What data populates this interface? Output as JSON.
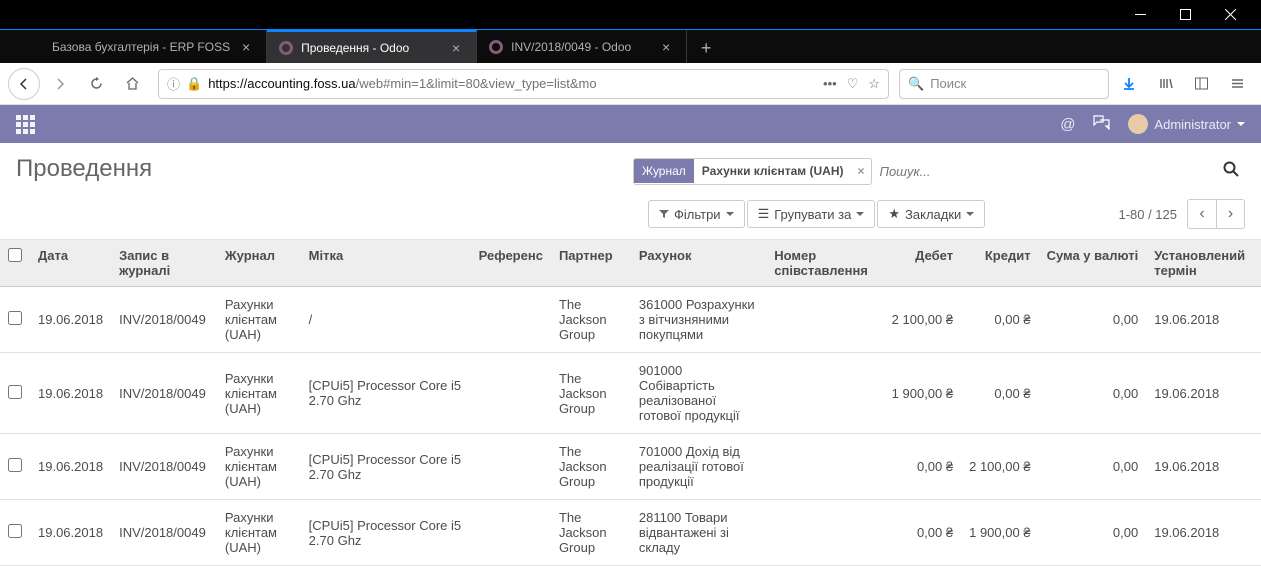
{
  "browser": {
    "tabs": [
      {
        "title": "Базова бухгалтерія - ERP FOSS",
        "icon": "generic"
      },
      {
        "title": "Проведення - Odoo",
        "icon": "odoo"
      },
      {
        "title": "INV/2018/0049 - Odoo",
        "icon": "odoo"
      }
    ],
    "url": {
      "host": "https://accounting.foss.ua",
      "path": "/web#min=1&limit=80&view_type=list&mo"
    },
    "search_placeholder": "Поиск"
  },
  "header": {
    "user": "Administrator"
  },
  "breadcrumb": "Проведення",
  "search": {
    "facet_label": "Журнал",
    "facet_value": "Рахунки клієнтам (UAH)",
    "placeholder": "Пошук..."
  },
  "toolbar": {
    "filters": "Фільтри",
    "groupby": "Групувати за",
    "favorites": "Закладки",
    "pager": "1-80 / 125"
  },
  "columns": {
    "date": "Дата",
    "journal_entry": "Запис в журналі",
    "journal": "Журнал",
    "label": "Мітка",
    "reference": "Референс",
    "partner": "Партнер",
    "account": "Рахунок",
    "matching": "Номер співставлення",
    "debit": "Дебет",
    "credit": "Кредит",
    "amount_currency": "Сума у валюті",
    "due_date": "Установлений термін"
  },
  "rows": [
    {
      "date": "19.06.2018",
      "entry": "INV/2018/0049",
      "journal": "Рахунки клієнтам (UAH)",
      "label": "/",
      "reference": "",
      "partner": "The Jackson Group",
      "account": "361000 Розрахунки з вітчизняними покупцями",
      "matching": "",
      "debit": "2 100,00 ₴",
      "credit": "0,00 ₴",
      "amount_currency": "0,00",
      "due": "19.06.2018"
    },
    {
      "date": "19.06.2018",
      "entry": "INV/2018/0049",
      "journal": "Рахунки клієнтам (UAH)",
      "label": "[CPUi5] Processor Core i5 2.70 Ghz",
      "reference": "",
      "partner": "The Jackson Group",
      "account": "901000 Собівартість реалізованої готової продукції",
      "matching": "",
      "debit": "1 900,00 ₴",
      "credit": "0,00 ₴",
      "amount_currency": "0,00",
      "due": "19.06.2018"
    },
    {
      "date": "19.06.2018",
      "entry": "INV/2018/0049",
      "journal": "Рахунки клієнтам (UAH)",
      "label": "[CPUi5] Processor Core i5 2.70 Ghz",
      "reference": "",
      "partner": "The Jackson Group",
      "account": "701000 Дохід від реалізації готової продукції",
      "matching": "",
      "debit": "0,00 ₴",
      "credit": "2 100,00 ₴",
      "amount_currency": "0,00",
      "due": "19.06.2018"
    },
    {
      "date": "19.06.2018",
      "entry": "INV/2018/0049",
      "journal": "Рахунки клієнтам (UAH)",
      "label": "[CPUi5] Processor Core i5 2.70 Ghz",
      "reference": "",
      "partner": "The Jackson Group",
      "account": "281100 Товари відвантажені зі складу",
      "matching": "",
      "debit": "0,00 ₴",
      "credit": "1 900,00 ₴",
      "amount_currency": "0,00",
      "due": "19.06.2018"
    }
  ]
}
